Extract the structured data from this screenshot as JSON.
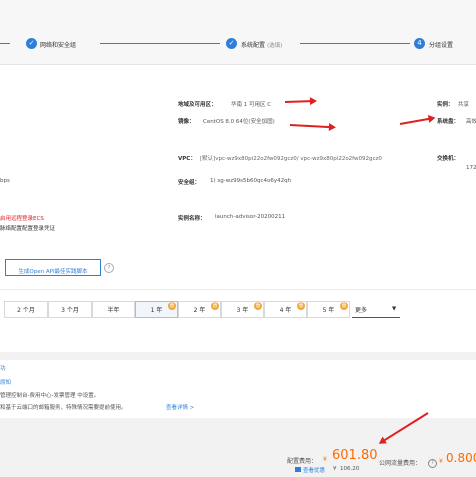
{
  "steps": {
    "step1": "网络和安全组",
    "step2_main": "系统配置",
    "step2_note": "(选填)",
    "step3_num": "4",
    "step3": "分组设置"
  },
  "summary": {
    "region_label": "地域及可用区：",
    "region_value": "华南 1 可用区 C",
    "image_label": "镜像：",
    "image_value": "CentOS 8.0 64位(安全加固)",
    "instance_label": "实例：",
    "instance_value": "共享",
    "sysdisk_label": "系统盘：",
    "sysdisk_value": "高效",
    "vpc_label": "VPC：",
    "vpc_value": "[默认]vpc-wz9x80pi22o2fw092gcz0/ vpc-wz9x80pi22o2fw092gcz0",
    "switch_label": "交换机：",
    "switch_value": "172",
    "bandwidth_fragment": "bps",
    "sg_label": "安全组：",
    "sg_value": "1) sg-wz99s5b60qc4o6y42qh",
    "instance_name_label": "实例名称：",
    "instance_name_value": "launch-advisor-20200211",
    "warn_line1": "启用远程登录ECS",
    "warn_line2": "脉络配置配置登录凭证",
    "api_button": "生成Open API最佳实践脚本",
    "help_icon": "?"
  },
  "duration": {
    "options": [
      "2 个月",
      "3 个月",
      "半年",
      "1 年",
      "2 年",
      "3 年",
      "4 年",
      "5 年"
    ],
    "selected": "1 年",
    "discount_badge": "惠",
    "more_label": "更多",
    "more_arrow": "▼"
  },
  "notes": {
    "line1": "功",
    "line2": "原知",
    "line3": "管理控制台-费用中心-发票管理 中设置。",
    "line4": "和基于云端口的邮箱服务，特殊情况需要提前使用。",
    "link": "查看详情 >"
  },
  "footer": {
    "config_fee_label": "配置费用：",
    "config_fee_currency": "¥",
    "config_fee_value": "601.80",
    "discount_label": "查看优惠",
    "discount_currency": "¥",
    "discount_value": "106.20",
    "traffic_label": "公网流量费用：",
    "traffic_currency": "¥",
    "traffic_value": "0.800"
  },
  "colors": {
    "accent": "#2f7fd8",
    "price": "#ff6a00",
    "annotation": "#e0201f",
    "warning": "#e0201f"
  }
}
